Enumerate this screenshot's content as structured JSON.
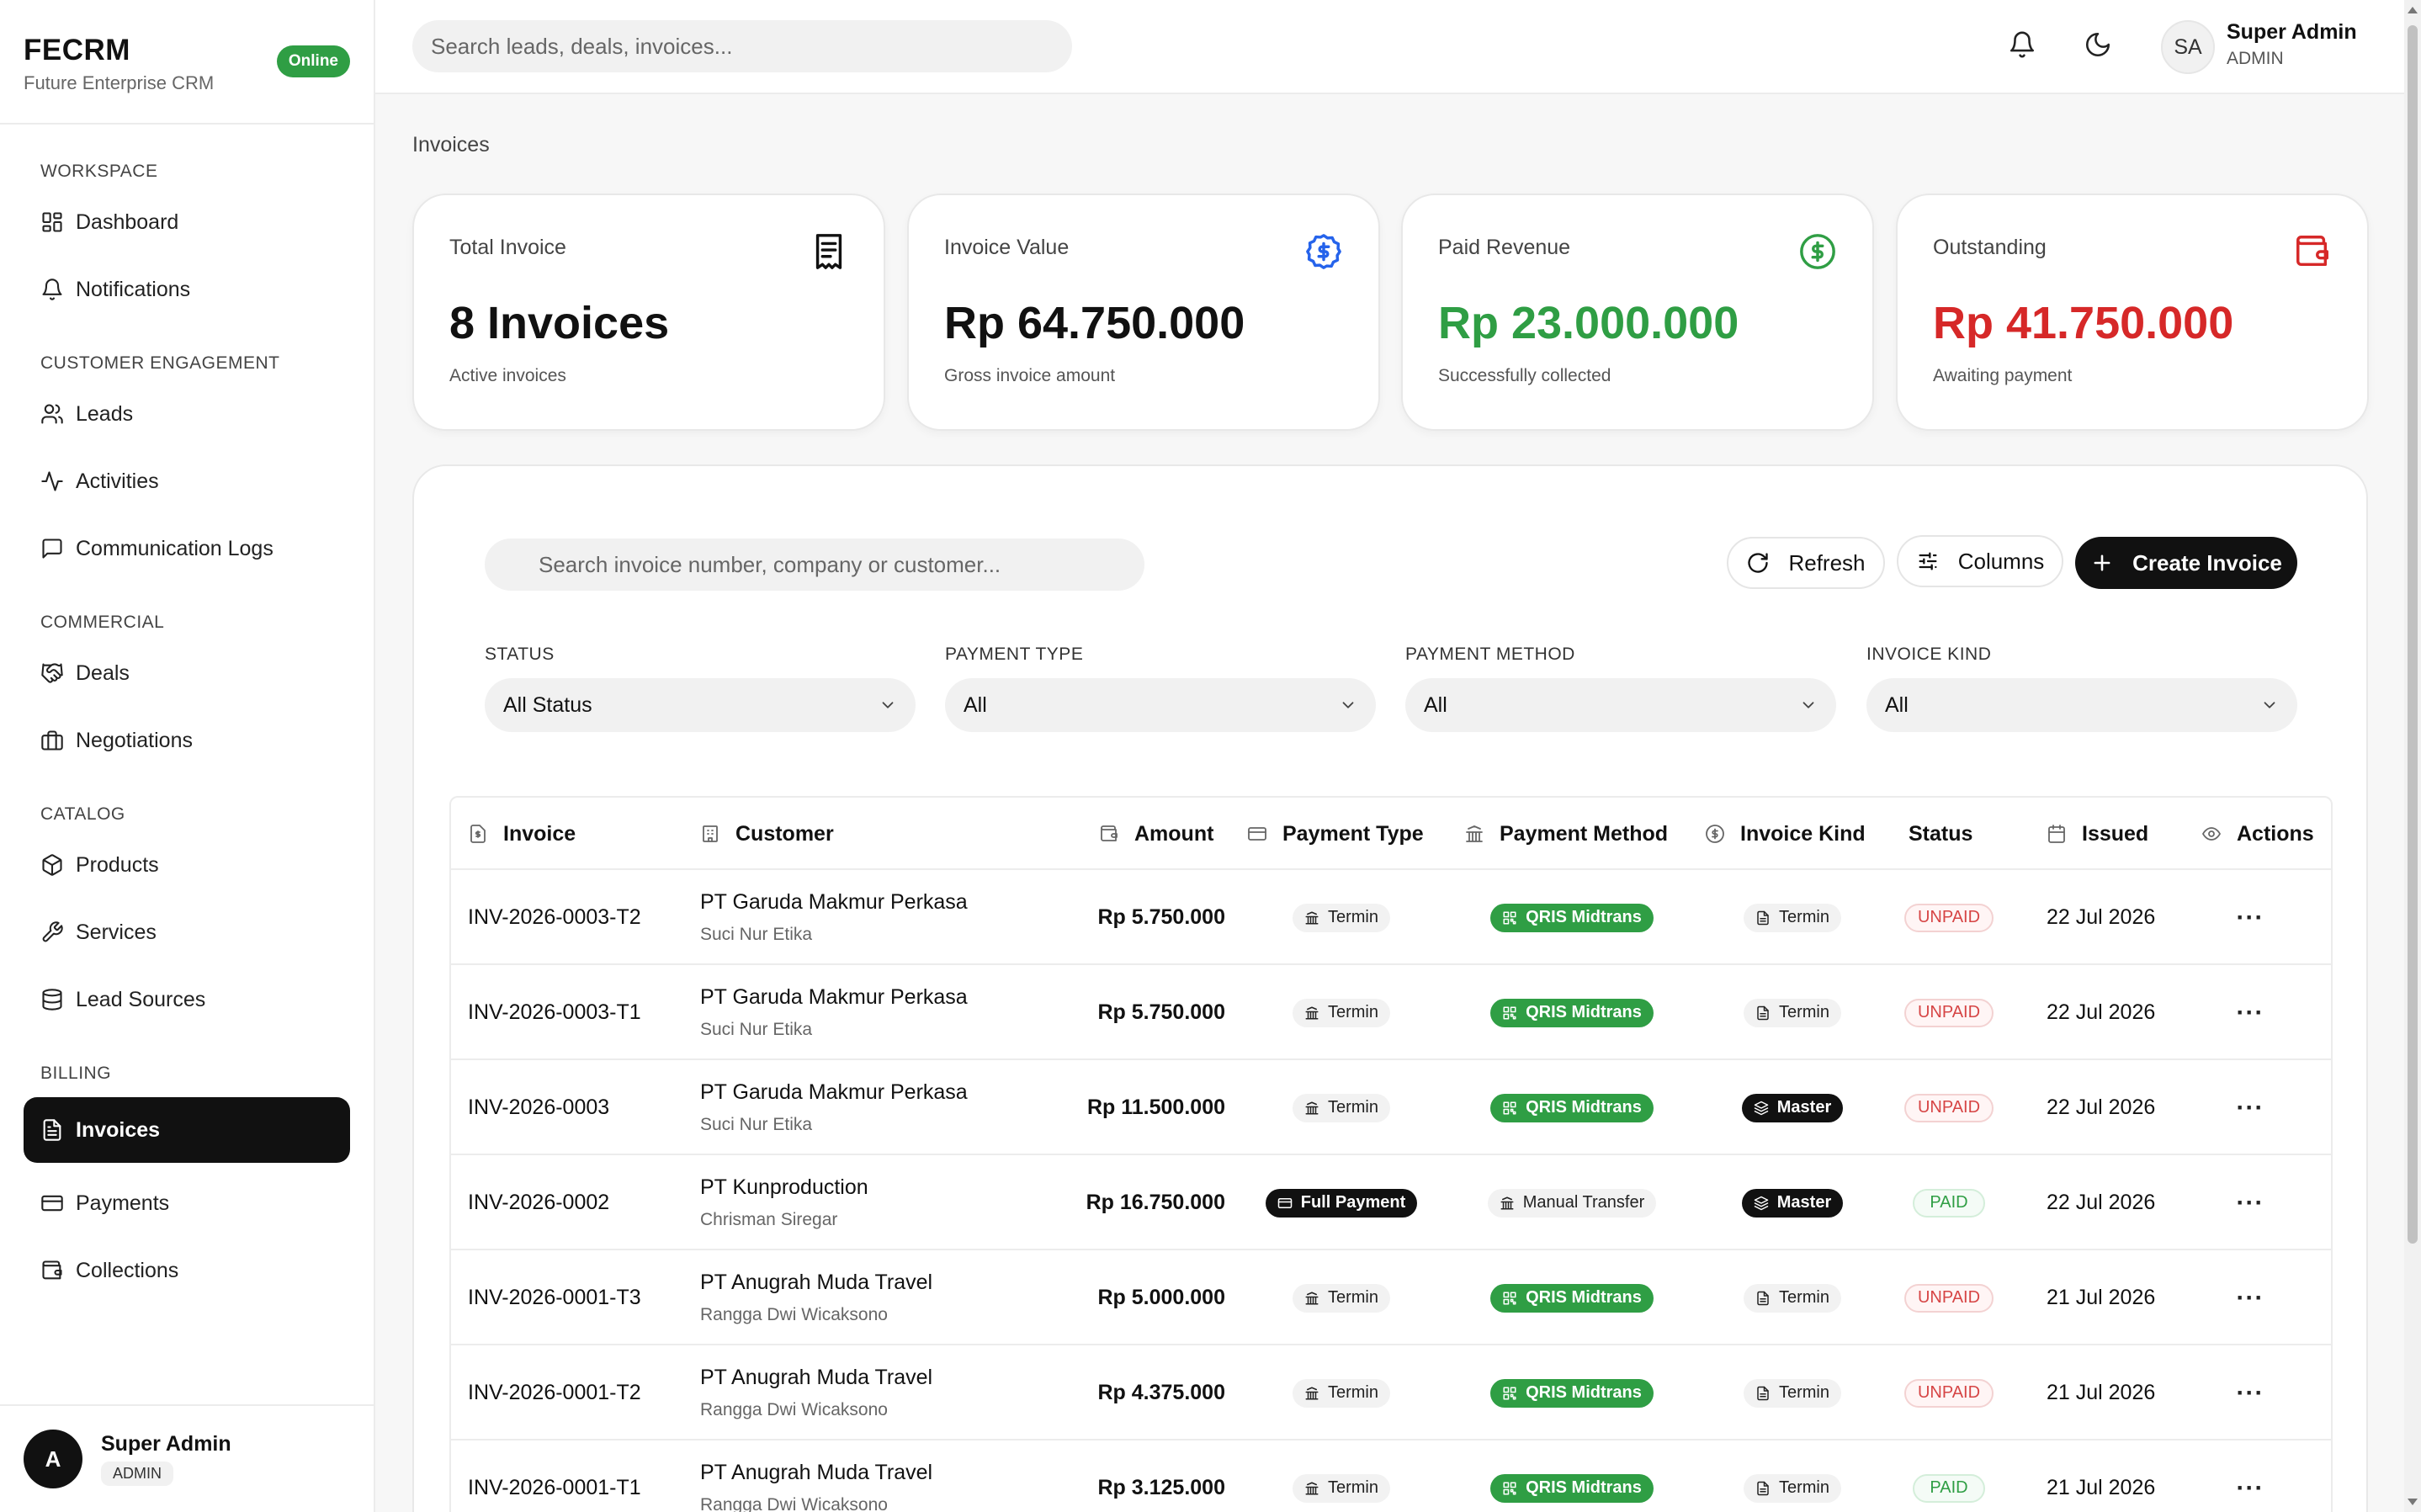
{
  "brand": {
    "title": "FECRM",
    "subtitle": "Future Enterprise CRM",
    "status": "Online"
  },
  "sidebar": {
    "sections": [
      {
        "title": "WORKSPACE",
        "items": [
          {
            "label": "Dashboard",
            "icon": "dashboard-icon"
          },
          {
            "label": "Notifications",
            "icon": "bell-icon"
          }
        ]
      },
      {
        "title": "CUSTOMER ENGAGEMENT",
        "items": [
          {
            "label": "Leads",
            "icon": "users-icon"
          },
          {
            "label": "Activities",
            "icon": "activity-icon"
          },
          {
            "label": "Communication Logs",
            "icon": "message-icon"
          }
        ]
      },
      {
        "title": "COMMERCIAL",
        "items": [
          {
            "label": "Deals",
            "icon": "handshake-icon"
          },
          {
            "label": "Negotiations",
            "icon": "briefcase-icon"
          }
        ]
      },
      {
        "title": "CATALOG",
        "items": [
          {
            "label": "Products",
            "icon": "box-icon"
          },
          {
            "label": "Services",
            "icon": "wrench-icon"
          },
          {
            "label": "Lead Sources",
            "icon": "database-icon"
          }
        ]
      },
      {
        "title": "BILLING",
        "items": [
          {
            "label": "Invoices",
            "icon": "file-icon",
            "active": true
          },
          {
            "label": "Payments",
            "icon": "card-icon"
          },
          {
            "label": "Collections",
            "icon": "wallet-icon"
          }
        ]
      }
    ],
    "footer": {
      "avatar": "A",
      "name": "Super Admin",
      "role": "ADMIN"
    }
  },
  "topbar": {
    "search_placeholder": "Search leads, deals, invoices...",
    "user": {
      "initials": "SA",
      "name": "Super Admin",
      "role": "ADMIN"
    }
  },
  "breadcrumb": "Invoices",
  "stats": [
    {
      "label": "Total Invoice",
      "value": "8 Invoices",
      "sub": "Active invoices",
      "icon": "receipt-icon",
      "color": "#111111"
    },
    {
      "label": "Invoice Value",
      "value": "Rp 64.750.000",
      "sub": "Gross invoice amount",
      "icon": "dollar-badge-icon",
      "color": "#111111"
    },
    {
      "label": "Paid Revenue",
      "value": "Rp 23.000.000",
      "sub": "Successfully collected",
      "icon": "dollar-circle-icon",
      "color": "#2f9e44"
    },
    {
      "label": "Outstanding",
      "value": "Rp 41.750.000",
      "sub": "Awaiting payment",
      "icon": "wallet-icon",
      "color": "#d62828"
    }
  ],
  "toolbar": {
    "search_placeholder": "Search invoice number, company or customer...",
    "refresh_label": "Refresh",
    "columns_label": "Columns",
    "create_label": "Create Invoice"
  },
  "filters": [
    {
      "label": "STATUS",
      "value": "All Status"
    },
    {
      "label": "PAYMENT TYPE",
      "value": "All"
    },
    {
      "label": "PAYMENT METHOD",
      "value": "All"
    },
    {
      "label": "INVOICE KIND",
      "value": "All"
    }
  ],
  "table": {
    "columns": [
      "Invoice",
      "Customer",
      "Amount",
      "Payment Type",
      "Payment Method",
      "Invoice Kind",
      "Status",
      "Issued",
      "Actions"
    ],
    "rows": [
      {
        "invoice": "INV-2026-0003-T2",
        "company": "PT Garuda Makmur Perkasa",
        "contact": "Suci Nur Etika",
        "amount": "Rp 5.750.000",
        "payment_type": "Termin",
        "payment_method": "QRIS Midtrans",
        "kind": "Termin",
        "status": "UNPAID",
        "issued": "22 Jul 2026"
      },
      {
        "invoice": "INV-2026-0003-T1",
        "company": "PT Garuda Makmur Perkasa",
        "contact": "Suci Nur Etika",
        "amount": "Rp 5.750.000",
        "payment_type": "Termin",
        "payment_method": "QRIS Midtrans",
        "kind": "Termin",
        "status": "UNPAID",
        "issued": "22 Jul 2026"
      },
      {
        "invoice": "INV-2026-0003",
        "company": "PT Garuda Makmur Perkasa",
        "contact": "Suci Nur Etika",
        "amount": "Rp 11.500.000",
        "payment_type": "Termin",
        "payment_method": "QRIS Midtrans",
        "kind": "Master",
        "status": "UNPAID",
        "issued": "22 Jul 2026"
      },
      {
        "invoice": "INV-2026-0002",
        "company": "PT Kunproduction",
        "contact": "Chrisman Siregar",
        "amount": "Rp 16.750.000",
        "payment_type": "Full Payment",
        "payment_method": "Manual Transfer",
        "kind": "Master",
        "status": "PAID",
        "issued": "22 Jul 2026"
      },
      {
        "invoice": "INV-2026-0001-T3",
        "company": "PT Anugrah Muda Travel",
        "contact": "Rangga Dwi Wicaksono",
        "amount": "Rp 5.000.000",
        "payment_type": "Termin",
        "payment_method": "QRIS Midtrans",
        "kind": "Termin",
        "status": "UNPAID",
        "issued": "21 Jul 2026"
      },
      {
        "invoice": "INV-2026-0001-T2",
        "company": "PT Anugrah Muda Travel",
        "contact": "Rangga Dwi Wicaksono",
        "amount": "Rp 4.375.000",
        "payment_type": "Termin",
        "payment_method": "QRIS Midtrans",
        "kind": "Termin",
        "status": "UNPAID",
        "issued": "21 Jul 2026"
      },
      {
        "invoice": "INV-2026-0001-T1",
        "company": "PT Anugrah Muda Travel",
        "contact": "Rangga Dwi Wicaksono",
        "amount": "Rp 3.125.000",
        "payment_type": "Termin",
        "payment_method": "QRIS Midtrans",
        "kind": "Termin",
        "status": "PAID",
        "issued": "21 Jul 2026"
      }
    ],
    "actions_glyph": "···"
  }
}
